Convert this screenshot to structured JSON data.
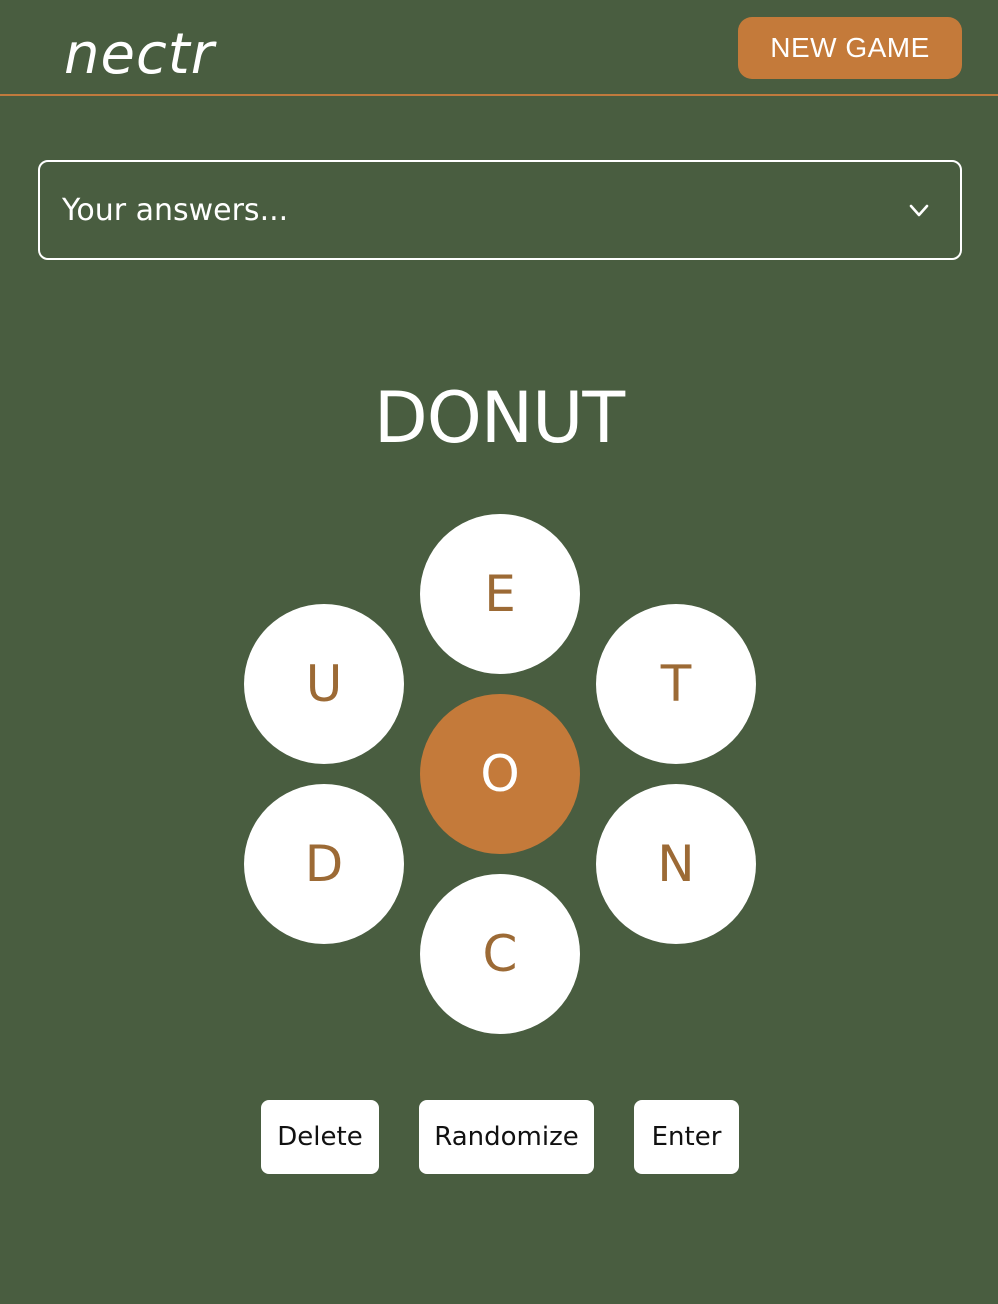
{
  "header": {
    "logo": "nectr",
    "new_game_label": "NEW GAME"
  },
  "answers": {
    "placeholder": "Your answers...",
    "toggle_icon": "chevron-down-icon"
  },
  "current_word": "DONUT",
  "letters": {
    "center": "O",
    "top": "E",
    "upper_left": "U",
    "upper_right": "T",
    "lower_left": "D",
    "lower_right": "N",
    "bottom": "C"
  },
  "actions": {
    "delete": "Delete",
    "randomize": "Randomize",
    "enter": "Enter"
  },
  "colors": {
    "background": "#495d40",
    "accent": "#c47a3a",
    "tile": "#ffffff",
    "tile_letter": "#9c6a35"
  }
}
